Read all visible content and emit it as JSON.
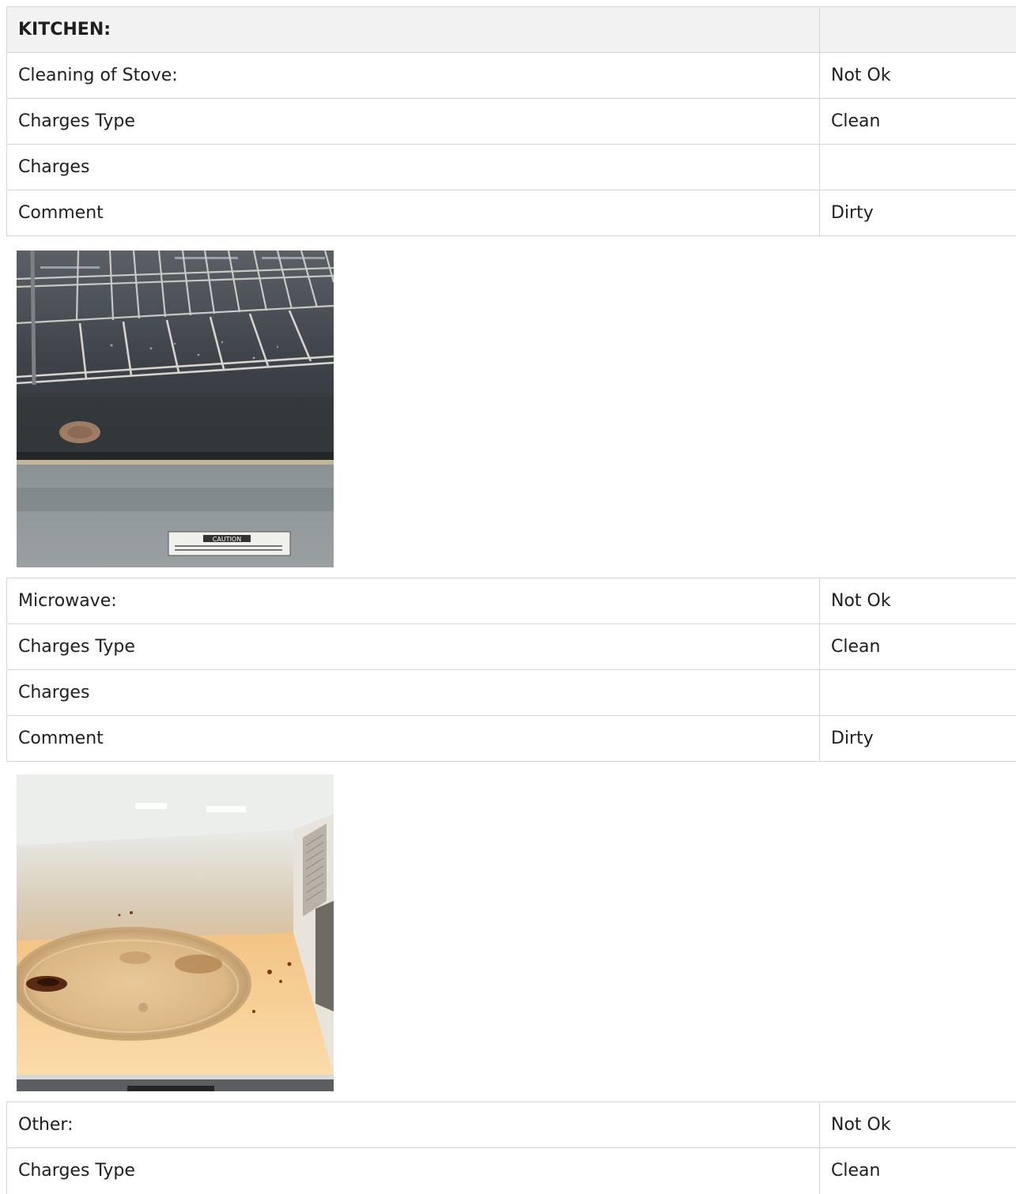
{
  "kitchen": {
    "heading": "KITCHEN:",
    "sections": [
      {
        "rows": [
          {
            "label": "Cleaning of Stove:",
            "value": "Not Ok"
          },
          {
            "label": "Charges Type",
            "value": "Clean"
          },
          {
            "label": "Charges",
            "value": ""
          },
          {
            "label": "Comment",
            "value": "Dirty"
          }
        ],
        "photo": {
          "icon": "oven-interior-photo",
          "label_text": "CAUTION"
        }
      },
      {
        "rows": [
          {
            "label": "Microwave:",
            "value": "Not Ok"
          },
          {
            "label": "Charges Type",
            "value": "Clean"
          },
          {
            "label": "Charges",
            "value": ""
          },
          {
            "label": "Comment",
            "value": "Dirty"
          }
        ],
        "photo": {
          "icon": "microwave-interior-photo"
        }
      },
      {
        "rows": [
          {
            "label": "Other:",
            "value": "Not Ok"
          },
          {
            "label": "Charges Type",
            "value": "Clean"
          }
        ]
      }
    ]
  }
}
